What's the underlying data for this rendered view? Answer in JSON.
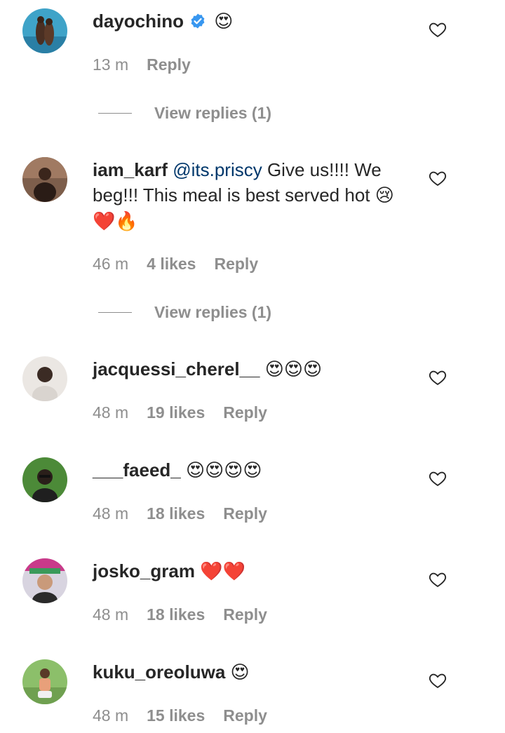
{
  "comments": [
    {
      "username": "dayochino",
      "verified": true,
      "mention": "",
      "text": "",
      "emojis": "😍",
      "time": "13 m",
      "likes": "",
      "reply": "Reply",
      "view_replies": "View replies (1)",
      "avatar_colors": [
        "#2f8fb6",
        "#5a3a2a"
      ]
    },
    {
      "username": "iam_karf",
      "verified": false,
      "mention": "@its.priscy",
      "text": "Give us!!!! We beg!!! This meal is best served hot",
      "emojis": "😢❤️🔥",
      "time": "46 m",
      "likes": "4 likes",
      "reply": "Reply",
      "view_replies": "View replies (1)",
      "avatar_colors": [
        "#8a6a55",
        "#3a2a22"
      ]
    },
    {
      "username": "jacquessi_cherel__",
      "verified": false,
      "mention": "",
      "text": "",
      "emojis": "😍😍😍",
      "time": "48 m",
      "likes": "19 likes",
      "reply": "Reply",
      "view_replies": "",
      "avatar_colors": [
        "#e8e4e0",
        "#3b2b24"
      ]
    },
    {
      "username": "___faeed_",
      "verified": false,
      "mention": "",
      "text": "",
      "emojis": "😍😍😍😍",
      "time": "48 m",
      "likes": "18 likes",
      "reply": "Reply",
      "view_replies": "",
      "avatar_colors": [
        "#4f8a3a",
        "#2a1f1a"
      ]
    },
    {
      "username": "josko_gram",
      "verified": false,
      "mention": "",
      "text": "",
      "emojis": "❤️❤️",
      "time": "48 m",
      "likes": "18 likes",
      "reply": "Reply",
      "view_replies": "",
      "avatar_colors": [
        "#c93a8a",
        "#3a9a5a"
      ]
    },
    {
      "username": "kuku_oreoluwa",
      "verified": false,
      "mention": "",
      "text": "",
      "emojis": "😍",
      "time": "48 m",
      "likes": "15 likes",
      "reply": "Reply",
      "view_replies": "",
      "avatar_colors": [
        "#8cbf6a",
        "#e8a07a"
      ]
    }
  ],
  "icons": {
    "like": "heart-outline-icon",
    "verified": "verified-badge-icon"
  },
  "colors": {
    "text": "#262626",
    "secondary": "#8e8e8e",
    "mention": "#00376b",
    "verified": "#3897f0"
  }
}
